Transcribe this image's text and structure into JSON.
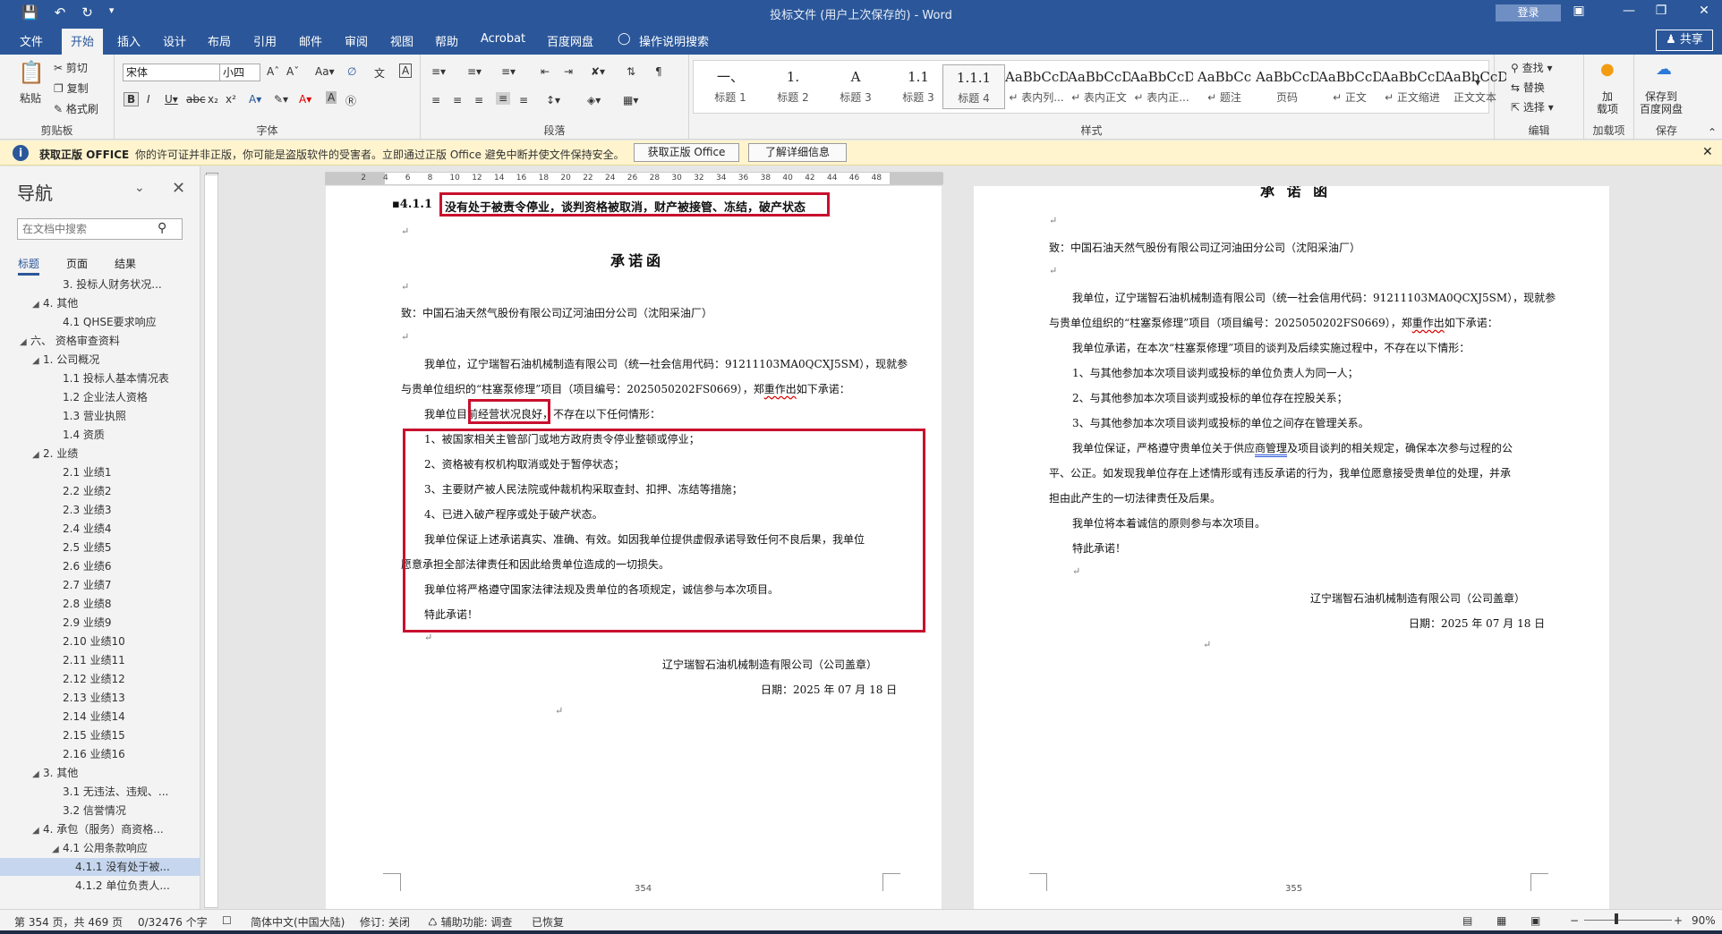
{
  "window": {
    "title": "投标文件 (用户上次保存的) - Word",
    "login_label": "登录",
    "share_label": "共享"
  },
  "qat": {
    "save_icon": "save-icon",
    "undo_icon": "undo-icon",
    "redo_icon": "redo-icon",
    "customize_icon": "chevron-down-icon"
  },
  "tabs": [
    "文件",
    "开始",
    "插入",
    "设计",
    "布局",
    "引用",
    "邮件",
    "审阅",
    "视图",
    "帮助",
    "Acrobat",
    "百度网盘",
    "操作说明搜索"
  ],
  "active_tab": "开始",
  "ribbon": {
    "clipboard": {
      "paste": "粘贴",
      "cut": "剪切",
      "copy": "复制",
      "format_painter": "格式刷",
      "label": "剪贴板"
    },
    "font": {
      "name": "宋体",
      "size": "小四",
      "label": "字体"
    },
    "paragraph": {
      "label": "段落"
    },
    "styles": {
      "label": "样式",
      "items": [
        {
          "preview": "一、",
          "name": "标题 1"
        },
        {
          "preview": "1.",
          "name": "标题 2"
        },
        {
          "preview": "A",
          "name": "标题 3"
        },
        {
          "preview": "1.1",
          "name": "标题 3"
        },
        {
          "preview": "1.1.1",
          "name": "标题 4"
        },
        {
          "preview": "AaBbCcD",
          "name": "↵ 表内列..."
        },
        {
          "preview": "AaBbCcDdI",
          "name": "↵ 表内正文"
        },
        {
          "preview": "AaBbCcDdI",
          "name": "↵ 表内正..."
        },
        {
          "preview": "AaBbCc",
          "name": "↵ 题注"
        },
        {
          "preview": "AaBbCcD",
          "name": "页码"
        },
        {
          "preview": "AaBbCcDdI",
          "name": "↵ 正文"
        },
        {
          "preview": "AaBbCcDd",
          "name": "↵ 正文缩进"
        },
        {
          "preview": "AaBbCcDdI",
          "name": "正文文本"
        }
      ]
    },
    "editing": {
      "find": "查找",
      "replace": "替换",
      "select": "选择",
      "label": "编辑"
    },
    "addins": {
      "label": "加载项",
      "button": "加\n载项"
    },
    "save": {
      "label": "保存",
      "button": "保存到\n百度网盘"
    }
  },
  "infobar": {
    "title": "获取正版 OFFICE",
    "message": "你的许可证并非正版，你可能是盗版软件的受害者。立即通过正版 Office 避免中断并使文件保持安全。",
    "btn_get": "获取正版 Office",
    "btn_learn": "了解详细信息"
  },
  "nav": {
    "title": "导航",
    "search_placeholder": "在文档中搜索",
    "tabs": [
      "标题",
      "页面",
      "结果"
    ],
    "items": [
      {
        "indent": 3,
        "tri": "",
        "label": "3. 投标人财务状况..."
      },
      {
        "indent": 2,
        "tri": "◢",
        "label": "4. 其他"
      },
      {
        "indent": 3,
        "tri": "",
        "label": "4.1 QHSE要求响应"
      },
      {
        "indent": 1,
        "tri": "◢",
        "label": "六、 资格审查资料"
      },
      {
        "indent": 2,
        "tri": "◢",
        "label": "1. 公司概况"
      },
      {
        "indent": 3,
        "tri": "",
        "label": "1.1 投标人基本情况表"
      },
      {
        "indent": 3,
        "tri": "",
        "label": "1.2 企业法人资格"
      },
      {
        "indent": 3,
        "tri": "",
        "label": "1.3 营业执照"
      },
      {
        "indent": 3,
        "tri": "",
        "label": "1.4 资质"
      },
      {
        "indent": 2,
        "tri": "◢",
        "label": "2. 业绩"
      },
      {
        "indent": 3,
        "tri": "",
        "label": "2.1 业绩1"
      },
      {
        "indent": 3,
        "tri": "",
        "label": "2.2 业绩2"
      },
      {
        "indent": 3,
        "tri": "",
        "label": "2.3 业绩3"
      },
      {
        "indent": 3,
        "tri": "",
        "label": "2.4 业绩4"
      },
      {
        "indent": 3,
        "tri": "",
        "label": "2.5 业绩5"
      },
      {
        "indent": 3,
        "tri": "",
        "label": "2.6 业绩6"
      },
      {
        "indent": 3,
        "tri": "",
        "label": "2.7 业绩7"
      },
      {
        "indent": 3,
        "tri": "",
        "label": "2.8 业绩8"
      },
      {
        "indent": 3,
        "tri": "",
        "label": "2.9 业绩9"
      },
      {
        "indent": 3,
        "tri": "",
        "label": "2.10 业绩10"
      },
      {
        "indent": 3,
        "tri": "",
        "label": "2.11 业绩11"
      },
      {
        "indent": 3,
        "tri": "",
        "label": "2.12 业绩12"
      },
      {
        "indent": 3,
        "tri": "",
        "label": "2.13 业绩13"
      },
      {
        "indent": 3,
        "tri": "",
        "label": "2.14 业绩14"
      },
      {
        "indent": 3,
        "tri": "",
        "label": "2.15 业绩15"
      },
      {
        "indent": 3,
        "tri": "",
        "label": "2.16 业绩16"
      },
      {
        "indent": 2,
        "tri": "◢",
        "label": "3. 其他"
      },
      {
        "indent": 3,
        "tri": "",
        "label": "3.1 无违法、违规、..."
      },
      {
        "indent": 3,
        "tri": "",
        "label": "3.2 信誉情况"
      },
      {
        "indent": 2,
        "tri": "◢",
        "label": "4. 承包（服务）商资格..."
      },
      {
        "indent": 3,
        "tri": "◢",
        "label": "4.1 公用条款响应"
      },
      {
        "indent": 4,
        "tri": "",
        "label": "4.1.1 没有处于被...",
        "selected": true
      },
      {
        "indent": 4,
        "tri": "",
        "label": "4.1.2 单位负责人..."
      }
    ]
  },
  "ruler": {
    "ticks": [
      "6",
      "4",
      "2",
      "",
      "2",
      "4",
      "6",
      "8",
      "10",
      "12",
      "14",
      "16",
      "18",
      "20",
      "22",
      "24",
      "26",
      "28",
      "30",
      "32",
      "34",
      "36",
      "38",
      "40",
      "42",
      "44",
      "46",
      "48"
    ]
  },
  "page_left": {
    "heading_num": "▪4.1.1",
    "heading_text": "没有处于被责令停业，谈判资格被取消，财产被接管、冻结，破产状态",
    "title": "承诺函",
    "to": "致：中国石油天然气股份有限公司辽河油田分公司（沈阳采油厂）",
    "p1a": "我单位，辽宁瑞智石油机械制造有限公司（统一社会信用代码：91211103MA0QCXJ5SM），现就参",
    "p1b_pre": "与贵单位组织的“柱塞泵修理”项目（项目编号：2025050202FS0669），郑",
    "p1b_sq": "重作出",
    "p1b_post": "如下承诺：",
    "p2_pre": "我单位目",
    "p2_box": "前经营状况良好",
    "p2_post": "，不存在以下任何情形：",
    "l1": "1、被国家相关主管部门或地方政府责令停业整顿或停业；",
    "l2": "2、资格被有权机构取消或处于暂停状态；",
    "l3": "3、主要财产被人民法院或仲裁机构采取查封、扣押、冻结等措施；",
    "l4": "4、已进入破产程序或处于破产状态。",
    "p3a": "我单位保证上述承诺真实、准确、有效。如因我单位提供虚假承诺导致任何不良后果，我单位",
    "p3b": "愿意承担全部法律责任和因此给贵单位造成的一切损失。",
    "p4": "我单位将严格遵守国家法律法规及贵单位的各项规定，诚信参与本次项目。",
    "p5": "特此承诺！",
    "sig": "辽宁瑞智石油机械制造有限公司（公司盖章）",
    "date": "日期：2025 年 07 月 18 日",
    "page_no": "354"
  },
  "page_right": {
    "title_fragment": "承 诺 函",
    "to": "致：中国石油天然气股份有限公司辽河油田分公司（沈阳采油厂）",
    "p1a": "我单位，辽宁瑞智石油机械制造有限公司（统一社会信用代码：91211103MA0QCXJ5SM），现就参",
    "p1b_pre": "与贵单位组织的“柱塞泵修理”项目（项目编号：2025050202FS0669），郑",
    "p1b_sq": "重作出",
    "p1b_post": "如下承诺：",
    "p2": "我单位承诺，在本次“柱塞泵修理”项目的谈判及后续实施过程中，不存在以下情形：",
    "l1": "1、与其他参加本次项目谈判或投标的单位负责人为同一人；",
    "l2": "2、与其他参加本次项目谈判或投标的单位存在控股关系；",
    "l3": "3、与其他参加本次项目谈判或投标的单位之间存在管理关系。",
    "p3a_pre": "我单位保证，严格遵守贵单位关于供应",
    "p3a_sq": "商管理",
    "p3a_post": "及项目谈判的相关规定，确保本次参与过程的公",
    "p3b": "平、公正。如发现我单位存在上述情形或有违反承诺的行为，我单位愿意接受贵单位的处理，并承",
    "p3c": "担由此产生的一切法律责任及后果。",
    "p4": "我单位将本着诚信的原则参与本次项目。",
    "p5": "特此承诺！",
    "sig": "辽宁瑞智石油机械制造有限公司（公司盖章）",
    "date": "日期：2025 年 07 月 18 日",
    "page_no": "355"
  },
  "status": {
    "page": "第 354 页，共 469 页",
    "words": "0/32476 个字",
    "lang": "简体中文(中国大陆)",
    "track": "修订: 关闭",
    "access": "辅助功能: 调查",
    "recovered": "已恢复",
    "zoom": "90%"
  },
  "colors": {
    "brand": "#2b579a",
    "highlight_box": "#c8102e",
    "infobar_bg": "#fff4ce"
  }
}
